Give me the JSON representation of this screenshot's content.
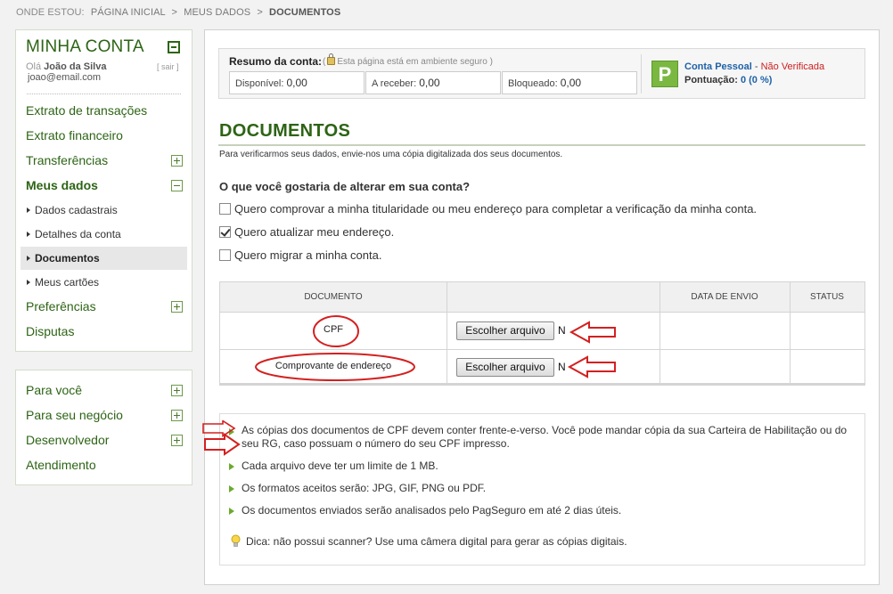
{
  "breadcrumb": {
    "label": "ONDE ESTOU:",
    "items": [
      "PÁGINA INICIAL",
      "MEUS DADOS"
    ],
    "separator": ">",
    "current": "DOCUMENTOS"
  },
  "sidebar": {
    "title": "MINHA CONTA",
    "greeting": "Olá",
    "user_name": "João da Silva",
    "logout": "[ sair ]",
    "email": "joao@email.com",
    "menu": [
      {
        "label": "Extrato de transações"
      },
      {
        "label": "Extrato financeiro"
      },
      {
        "label": "Transferências",
        "toggle": "plus"
      },
      {
        "label": "Meus dados",
        "toggle": "minus"
      }
    ],
    "submenu": [
      {
        "label": "Dados cadastrais"
      },
      {
        "label": "Detalhes da conta"
      },
      {
        "label": "Documentos",
        "active": true
      },
      {
        "label": "Meus cartões"
      }
    ],
    "menu_after": [
      {
        "label": "Preferências",
        "toggle": "plus"
      },
      {
        "label": "Disputas"
      }
    ],
    "secondary": [
      {
        "label": "Para você",
        "toggle": "plus"
      },
      {
        "label": "Para seu negócio",
        "toggle": "plus"
      },
      {
        "label": "Desenvolvedor",
        "toggle": "plus"
      },
      {
        "label": "Atendimento"
      }
    ]
  },
  "summary": {
    "title": "Resumo da conta:",
    "secure_open": "(",
    "secure_note": "Esta página está em ambiente seguro",
    "secure_close": ")",
    "balances": [
      {
        "label": "Disponível:",
        "value": "0,00"
      },
      {
        "label": "A receber:",
        "value": "0,00"
      },
      {
        "label": "Bloqueado:",
        "value": "0,00"
      }
    ],
    "badge": "P",
    "account_type": "Conta Pessoal",
    "dash": " - ",
    "account_status": "Não Verificada",
    "score_label": "Pontuação:",
    "score_value": "0 (0 %)"
  },
  "page": {
    "title": "DOCUMENTOS",
    "intro": "Para verificarmos seus dados, envie-nos uma cópia digitalizada dos seus documentos.",
    "question": "O que você gostaria de alterar em sua conta?",
    "options": [
      {
        "label": "Quero comprovar a minha titularidade ou meu endereço para completar a verificação da minha conta.",
        "checked": false
      },
      {
        "label": "Quero atualizar meu endereço.",
        "checked": true
      },
      {
        "label": "Quero migrar a minha conta.",
        "checked": false
      }
    ]
  },
  "table": {
    "headers": [
      "DOCUMENTO",
      "",
      "DATA DE ENVIO",
      "STATUS"
    ],
    "rows": [
      {
        "document": "CPF",
        "button": "Escolher arquivo",
        "trail": "N",
        "date": "",
        "status": ""
      },
      {
        "document": "Comprovante de endereço",
        "button": "Escolher arquivo",
        "trail": "N",
        "date": "",
        "status": ""
      }
    ]
  },
  "info": {
    "bullets": [
      "As cópias dos documentos de CPF devem conter frente-e-verso. Você pode mandar cópia da sua Carteira de Habilitação ou do seu RG, caso possuam o número do seu CPF impresso.",
      "Cada arquivo deve ter um limite de 1 MB.",
      "Os formatos aceitos serão: JPG, GIF, PNG ou PDF.",
      "Os documentos enviados serão analisados pelo PagSeguro em até 2 dias úteis."
    ],
    "tip": "Dica: não possui scanner? Use uma câmera digital para gerar as cópias digitais."
  },
  "colors": {
    "brand_green": "#2d6415",
    "link_blue": "#1f62a8",
    "alert_red": "#cc1f1f",
    "annotation_red": "#d42020",
    "bullet_green": "#6aab2a"
  },
  "icons": [
    "collapse-icon",
    "plus-icon",
    "minus-icon",
    "arrow-right-icon",
    "lock-icon",
    "checkbox-icon",
    "bullet-arrow-icon",
    "lightbulb-icon",
    "pointer-arrow-icon"
  ]
}
